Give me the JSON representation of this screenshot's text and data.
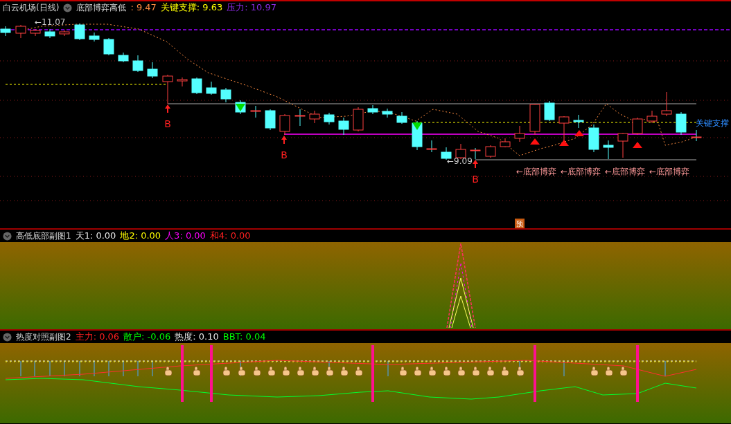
{
  "header": {
    "title": "白云机场(日线)",
    "indicator": "底部博弈高低",
    "readouts": [
      {
        "text": ": 9.47",
        "color": "#ff8c40"
      },
      {
        "text": "关键支撑: 9.63",
        "color": "#ffff00"
      },
      {
        "text": "压力: 10.97",
        "color": "#8a2be2"
      }
    ]
  },
  "main_chart": {
    "price_labels": [
      "←11.07",
      "←9.09"
    ],
    "buy_signals": [
      "B",
      "B",
      "B"
    ],
    "pattern_labels": [
      "←底部博弈",
      "←底部博弈",
      "←底部博弈",
      "←底部博弈"
    ],
    "support_label": "关键支撑",
    "forecast_badge": "预"
  },
  "panels": [
    {
      "title": "高低底部副图1",
      "readouts": [
        {
          "text": "天1: 0.00",
          "color": "#e8e8e8"
        },
        {
          "text": "地2: 0.00",
          "color": "#ffff00"
        },
        {
          "text": "人3: 0.00",
          "color": "#ff00ff"
        },
        {
          "text": "和4: 0.00",
          "color": "#ff2020"
        }
      ]
    },
    {
      "title": "热度对照副图2",
      "readouts": [
        {
          "text": "主力: 0.06",
          "color": "#ff2020"
        },
        {
          "text": "散户: -0.06",
          "color": "#00ff00"
        },
        {
          "text": "热度: 0.10",
          "color": "#e8e8e8"
        },
        {
          "text": "BBT: 0.04",
          "color": "#00ff00"
        }
      ]
    }
  ]
}
